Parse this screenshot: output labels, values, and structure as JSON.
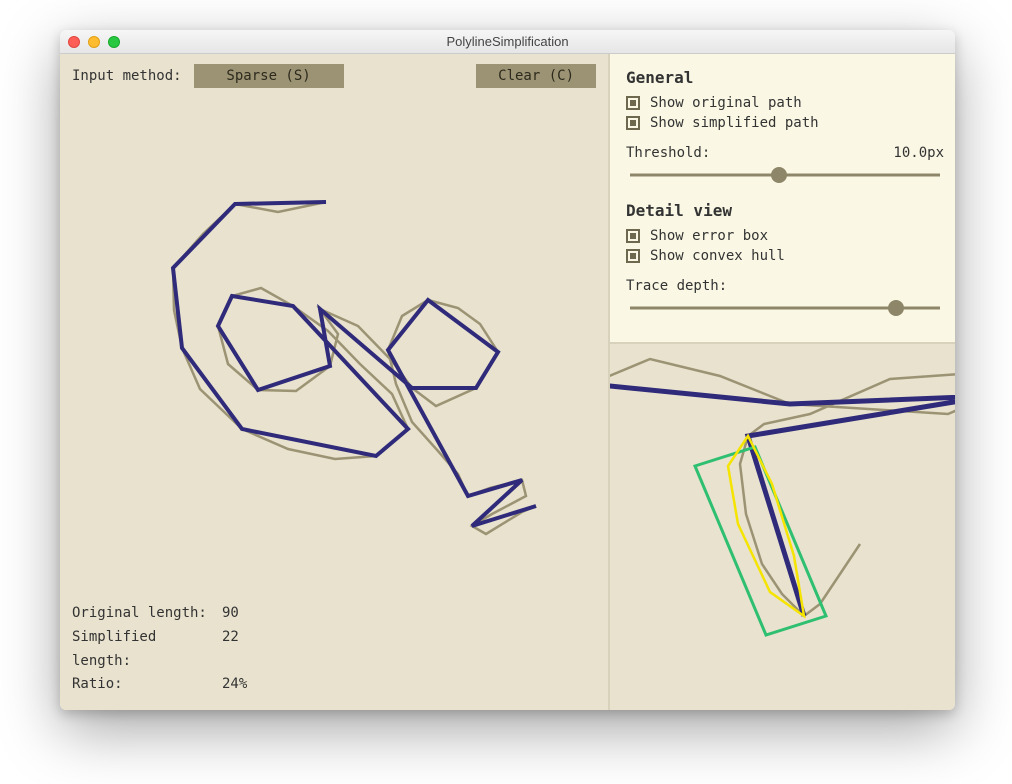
{
  "window": {
    "title": "PolylineSimplification"
  },
  "toolbar": {
    "input_method_label": "Input method:",
    "sparse_button": "Sparse (S)",
    "clear_button": "Clear (C)"
  },
  "stats": {
    "original_length_label": "Original length:",
    "original_length_value": "90",
    "simplified_length_label": "Simplified length:",
    "simplified_length_value": "22",
    "ratio_label": "Ratio:",
    "ratio_value": "24%"
  },
  "general": {
    "heading": "General",
    "show_original_label": "Show original path",
    "show_original_checked": true,
    "show_simplified_label": "Show simplified path",
    "show_simplified_checked": true,
    "threshold_label": "Threshold:",
    "threshold_value": "10.0px",
    "threshold_position_percent": 48
  },
  "detail": {
    "heading": "Detail view",
    "show_error_box_label": "Show error box",
    "show_error_box_checked": true,
    "show_convex_hull_label": "Show convex hull",
    "show_convex_hull_checked": true,
    "trace_depth_label": "Trace depth:",
    "trace_depth_position_percent": 85
  },
  "colors": {
    "original_path": "#9b9373",
    "simplified_path": "#2f2a7a",
    "error_box": "#2fbf71",
    "convex_hull": "#f5e400"
  }
}
